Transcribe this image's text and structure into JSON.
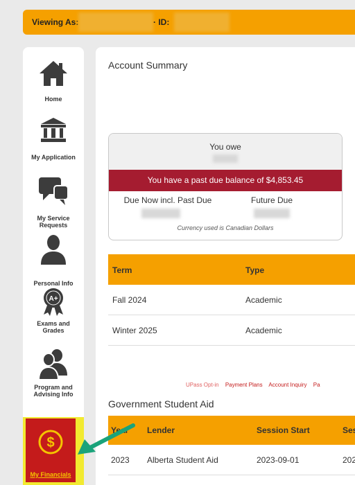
{
  "topbar": {
    "viewing_label": "Viewing As:",
    "id_label": "· ID:"
  },
  "sidebar": {
    "items": [
      {
        "label": "Home"
      },
      {
        "label": "My Application"
      },
      {
        "label_line1": "My Service",
        "label_line2": "Requests"
      },
      {
        "label": "Personal Info"
      },
      {
        "label_line1": "Exams and",
        "label_line2": "Grades"
      },
      {
        "label_line1": "Program and",
        "label_line2": "Advising Info"
      },
      {
        "label": "My Financials"
      }
    ],
    "badge": "A+"
  },
  "main": {
    "title": "Account Summary",
    "owe_card": {
      "you_owe_label": "You owe",
      "past_due_text": "You have a past due balance of $4,853.45",
      "due_now_label": "Due Now incl. Past Due",
      "future_due_label": "Future Due",
      "currency_note": "Currency used is Canadian Dollars"
    },
    "term_table": {
      "headers": [
        "Term",
        "Type"
      ],
      "rows": [
        [
          "Fall 2024",
          "Academic"
        ],
        [
          "Winter 2025",
          "Academic"
        ]
      ]
    },
    "links": [
      "UPass Opt-in",
      "Payment Plans",
      "Account Inquiry",
      "Pa"
    ],
    "aid_title": "Government Student Aid",
    "aid_table": {
      "headers": [
        "Year",
        "Lender",
        "Session Start",
        "Ses"
      ],
      "rows": [
        [
          "2023",
          "Alberta Student Aid",
          "2023-09-01",
          "202"
        ]
      ]
    }
  },
  "colors": {
    "accent_orange": "#f5a000",
    "past_due_red": "#a51c30",
    "financials_red": "#c41b1b",
    "highlight_yellow": "#f2ea30",
    "arrow_green": "#1aa37a",
    "link_red": "#c41b1b"
  },
  "icons": [
    "home-icon",
    "bank-icon",
    "chat-bubbles-icon",
    "person-icon",
    "award-badge-icon",
    "people-icon",
    "dollar-circle-icon",
    "arrow-icon"
  ]
}
